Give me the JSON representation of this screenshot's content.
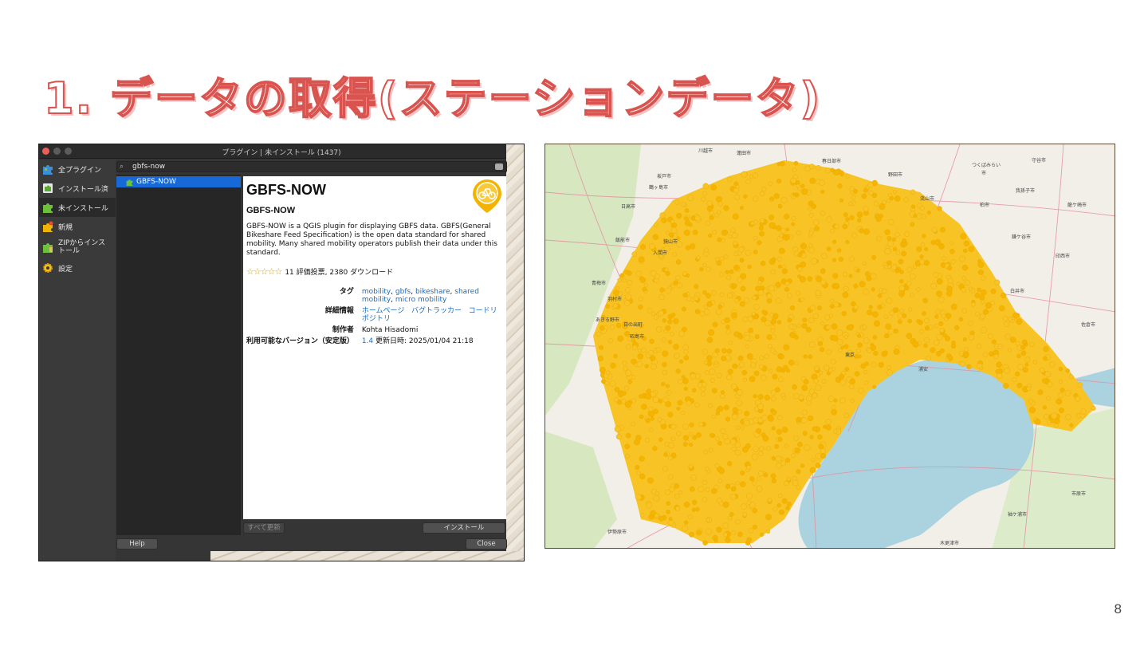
{
  "slide": {
    "title": "1. データの取得(ステーションデータ)",
    "page_number": "8"
  },
  "qgis": {
    "window_title": "プラグイン | 未インストール (1437)",
    "sidebar": [
      {
        "label": "全プラグイン",
        "icon": "puzzle-icon"
      },
      {
        "label": "インストール済",
        "icon": "puzzle-icon"
      },
      {
        "label": "未インストール",
        "icon": "puzzle-icon"
      },
      {
        "label": "新規",
        "icon": "new-plugin-icon"
      },
      {
        "label": "ZIPからインス\nトール",
        "icon": "zip-install-icon"
      },
      {
        "label": "設定",
        "icon": "gear-icon"
      }
    ],
    "search": {
      "value": "gbfs-now"
    },
    "list": [
      "GBFS-NOW"
    ],
    "details": {
      "name": "GBFS-NOW",
      "subname": "GBFS-NOW",
      "description": "GBFS-NOW is a QGIS plugin for displaying GBFS data. GBFS(General Bikeshare Feed Specification) is the open data standard for shared mobility. Many shared mobility operators publish their data under this standard.",
      "rating": 5,
      "rating_text": "11 評価投票, 2380 ダウンロード",
      "tags_label": "タグ",
      "tags": [
        "mobility",
        "gbfs",
        "bikeshare",
        "shared mobility",
        "micro mobility"
      ],
      "more_info_label": "詳細情報",
      "links": [
        "ホームページ",
        "バグトラッカー",
        "コードリポジトリ"
      ],
      "author_label": "制作者",
      "author": "Kohta Hisadomi",
      "version_label": "利用可能なバージョン（安定版）",
      "version": "1.4",
      "updated_text": "更新日時: 2025/01/04 21:18"
    },
    "buttons": {
      "upgrade_all": "すべて更新",
      "install": "インストール",
      "help": "Help",
      "close": "Close"
    }
  },
  "map": {
    "labels": [
      "川越市",
      "蓮田市",
      "春日部市",
      "つくばみらい",
      "市",
      "守谷市",
      "野田市",
      "坂戸市",
      "鶴ヶ島市",
      "日高市",
      "流山市",
      "我孫子市",
      "柏市",
      "龍ケ崎市",
      "飯能市",
      "狭山市",
      "入間市",
      "鎌ケ谷市",
      "印西市",
      "青梅市",
      "羽村市",
      "あきる野市",
      "日の出町",
      "昭島市",
      "白井市",
      "佐倉市",
      "東京",
      "浦安",
      "市原市",
      "袖ケ浦市",
      "伊勢原市",
      "木更津市"
    ],
    "colors": {
      "land": "#f2efe9",
      "water": "#aad3df",
      "roads": "#e892a2",
      "parks": "#c8e6b0",
      "markers": "#f7c325"
    }
  }
}
